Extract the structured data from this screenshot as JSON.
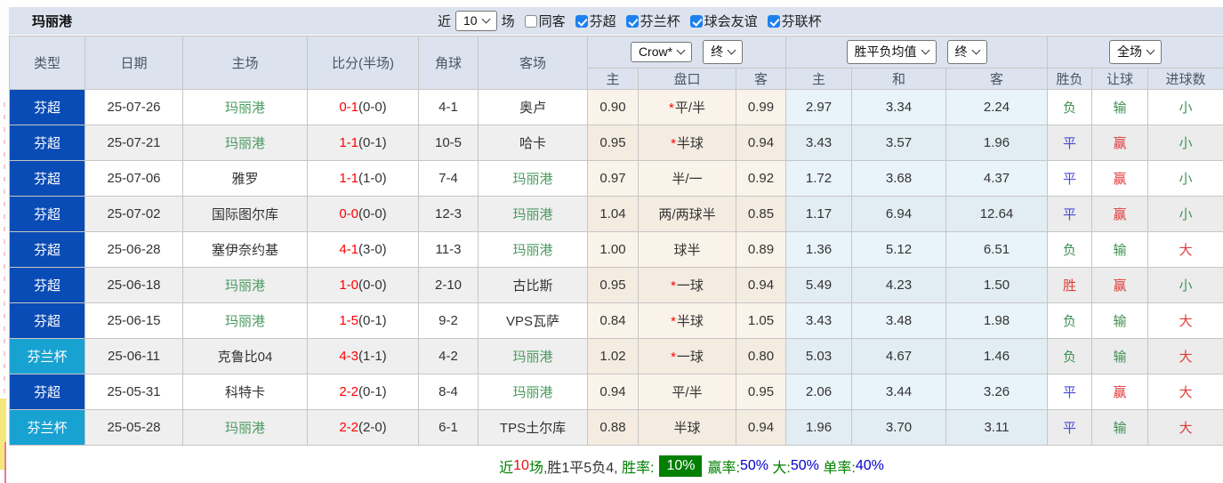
{
  "title": "玛丽港",
  "colors": {
    "league_super_bg": "#0a4cb5",
    "league_cup_bg": "#18a2d2",
    "header_bg": "#dce3ee",
    "odds_col_bg": "#faf3e9",
    "avg_col_bg": "#e9f3fa",
    "score_red": "#ff0000",
    "self_team_green": "#4a9a5f",
    "win_red": "#e03b3b",
    "draw_blue": "#4a4ad8",
    "lose_green": "#3f9054",
    "checkbox_blue": "#1e80ef",
    "badge_green": "#008000",
    "footer_blue": "#0000cc"
  },
  "filter_bar": {
    "recent_label": "近",
    "recent_value": "10",
    "games_label": "场",
    "same_opponent_label": "同客",
    "leagues": [
      {
        "label": "芬超",
        "checked": true
      },
      {
        "label": "芬兰杯",
        "checked": true
      },
      {
        "label": "球会友谊",
        "checked": true
      },
      {
        "label": "芬联杯",
        "checked": true
      }
    ]
  },
  "table": {
    "columns": [
      "类型",
      "日期",
      "主场",
      "比分(半场)",
      "角球",
      "客场"
    ],
    "odds_group": {
      "company": "Crow*",
      "time": "终",
      "sub": [
        "主",
        "盘口",
        "客"
      ]
    },
    "avg_group": {
      "name": "胜平负均值",
      "time": "终",
      "sub": [
        "主",
        "和",
        "客"
      ]
    },
    "result_group": {
      "scope": "全场",
      "sub": [
        "胜负",
        "让球",
        "进球数"
      ]
    },
    "rows": [
      {
        "league": "芬超",
        "league_class": "lg-super",
        "date": "25-07-26",
        "home": "玛丽港",
        "home_self": true,
        "score": "0-1",
        "half": "(0-0)",
        "corner": "4-1",
        "away": "奥卢",
        "away_self": false,
        "odds_home": "0.90",
        "star": "*",
        "handicap": "平/半",
        "odds_away": "0.99",
        "avg": [
          "2.97",
          "3.34",
          "2.24"
        ],
        "result": {
          "text": "负",
          "c": "green"
        },
        "let": {
          "text": "输",
          "c": "green"
        },
        "goal": {
          "text": "小",
          "c": "green"
        }
      },
      {
        "league": "芬超",
        "league_class": "lg-super",
        "date": "25-07-21",
        "home": "玛丽港",
        "home_self": true,
        "score": "1-1",
        "half": "(0-1)",
        "corner": "10-5",
        "away": "哈卡",
        "away_self": false,
        "odds_home": "0.95",
        "star": "*",
        "handicap": "半球",
        "odds_away": "0.94",
        "avg": [
          "3.43",
          "3.57",
          "1.96"
        ],
        "result": {
          "text": "平",
          "c": "blue"
        },
        "let": {
          "text": "赢",
          "c": "red"
        },
        "goal": {
          "text": "小",
          "c": "green"
        }
      },
      {
        "league": "芬超",
        "league_class": "lg-super",
        "date": "25-07-06",
        "home": "雅罗",
        "home_self": false,
        "score": "1-1",
        "half": "(1-0)",
        "corner": "7-4",
        "away": "玛丽港",
        "away_self": true,
        "odds_home": "0.97",
        "handicap": "半/一",
        "odds_away": "0.92",
        "avg": [
          "1.72",
          "3.68",
          "4.37"
        ],
        "result": {
          "text": "平",
          "c": "blue"
        },
        "let": {
          "text": "赢",
          "c": "red"
        },
        "goal": {
          "text": "小",
          "c": "green"
        }
      },
      {
        "league": "芬超",
        "league_class": "lg-super",
        "date": "25-07-02",
        "home": "国际图尔库",
        "home_self": false,
        "score": "0-0",
        "half": "(0-0)",
        "corner": "12-3",
        "away": "玛丽港",
        "away_self": true,
        "odds_home": "1.04",
        "handicap": "两/两球半",
        "odds_away": "0.85",
        "avg": [
          "1.17",
          "6.94",
          "12.64"
        ],
        "result": {
          "text": "平",
          "c": "blue"
        },
        "let": {
          "text": "赢",
          "c": "red"
        },
        "goal": {
          "text": "小",
          "c": "green"
        }
      },
      {
        "league": "芬超",
        "league_class": "lg-super",
        "date": "25-06-28",
        "home": "塞伊奈约基",
        "home_self": false,
        "score": "4-1",
        "half": "(3-0)",
        "corner": "11-3",
        "away": "玛丽港",
        "away_self": true,
        "odds_home": "1.00",
        "handicap": "球半",
        "odds_away": "0.89",
        "avg": [
          "1.36",
          "5.12",
          "6.51"
        ],
        "result": {
          "text": "负",
          "c": "green"
        },
        "let": {
          "text": "输",
          "c": "green"
        },
        "goal": {
          "text": "大",
          "c": "red"
        }
      },
      {
        "league": "芬超",
        "league_class": "lg-super",
        "date": "25-06-18",
        "home": "玛丽港",
        "home_self": true,
        "score": "1-0",
        "half": "(0-0)",
        "corner": "2-10",
        "away": "古比斯",
        "away_self": false,
        "odds_home": "0.95",
        "star": "*",
        "handicap": "一球",
        "odds_away": "0.94",
        "avg": [
          "5.49",
          "4.23",
          "1.50"
        ],
        "result": {
          "text": "胜",
          "c": "red"
        },
        "let": {
          "text": "赢",
          "c": "red"
        },
        "goal": {
          "text": "小",
          "c": "green"
        }
      },
      {
        "league": "芬超",
        "league_class": "lg-super",
        "date": "25-06-15",
        "home": "玛丽港",
        "home_self": true,
        "score": "1-5",
        "half": "(0-1)",
        "corner": "9-2",
        "away": "VPS瓦萨",
        "away_self": false,
        "odds_home": "0.84",
        "star": "*",
        "handicap": "半球",
        "odds_away": "1.05",
        "avg": [
          "3.43",
          "3.48",
          "1.98"
        ],
        "result": {
          "text": "负",
          "c": "green"
        },
        "let": {
          "text": "输",
          "c": "green"
        },
        "goal": {
          "text": "大",
          "c": "red"
        }
      },
      {
        "league": "芬兰杯",
        "league_class": "lg-cup",
        "date": "25-06-11",
        "home": "克鲁比04",
        "home_self": false,
        "score": "4-3",
        "half": "(1-1)",
        "corner": "4-2",
        "away": "玛丽港",
        "away_self": true,
        "odds_home": "1.02",
        "star": "*",
        "handicap": "一球",
        "odds_away": "0.80",
        "avg": [
          "5.03",
          "4.67",
          "1.46"
        ],
        "result": {
          "text": "负",
          "c": "green"
        },
        "let": {
          "text": "输",
          "c": "green"
        },
        "goal": {
          "text": "大",
          "c": "red"
        }
      },
      {
        "league": "芬超",
        "league_class": "lg-super",
        "date": "25-05-31",
        "home": "科特卡",
        "home_self": false,
        "score": "2-2",
        "half": "(0-1)",
        "corner": "8-4",
        "away": "玛丽港",
        "away_self": true,
        "odds_home": "0.94",
        "handicap": "平/半",
        "odds_away": "0.95",
        "avg": [
          "2.06",
          "3.44",
          "3.26"
        ],
        "result": {
          "text": "平",
          "c": "blue"
        },
        "let": {
          "text": "赢",
          "c": "red"
        },
        "goal": {
          "text": "大",
          "c": "red"
        }
      },
      {
        "league": "芬兰杯",
        "league_class": "lg-cup",
        "date": "25-05-28",
        "home": "玛丽港",
        "home_self": true,
        "score": "2-2",
        "half": "(2-0)",
        "corner": "6-1",
        "away": "TPS土尔库",
        "away_self": false,
        "odds_home": "0.88",
        "handicap": "半球",
        "odds_away": "0.94",
        "avg": [
          "1.96",
          "3.70",
          "3.11"
        ],
        "result": {
          "text": "平",
          "c": "blue"
        },
        "let": {
          "text": "输",
          "c": "green"
        },
        "goal": {
          "text": "大",
          "c": "red"
        }
      }
    ]
  },
  "footer": {
    "segments": [
      {
        "t": "近",
        "c": "green"
      },
      {
        "t": "10",
        "c": "red"
      },
      {
        "t": "场,",
        "c": "green"
      },
      {
        "t": "胜1平5负4, ",
        "c": "dark"
      },
      {
        "t": "胜率:",
        "c": "green"
      },
      {
        "t": "10%",
        "c": "badge"
      },
      {
        "t": "赢率:",
        "c": "green"
      },
      {
        "t": "50%",
        "c": "blue"
      },
      {
        "t": " 大:",
        "c": "green"
      },
      {
        "t": "50%",
        "c": "blue"
      },
      {
        "t": " 单率:",
        "c": "green"
      },
      {
        "t": "40%",
        "c": "blue"
      }
    ]
  }
}
